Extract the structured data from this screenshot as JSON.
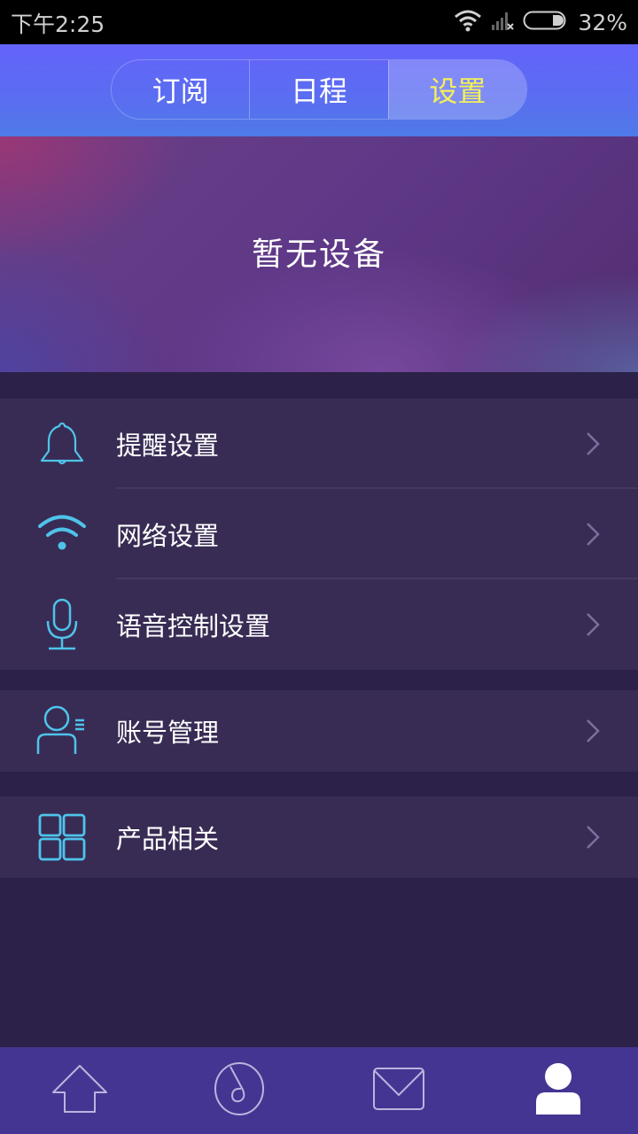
{
  "status_bar": {
    "time": "下午2:25",
    "battery_percent": "32%",
    "icons": [
      "wifi-icon",
      "cellular-no-signal-icon",
      "battery-icon"
    ]
  },
  "header": {
    "tabs": [
      {
        "label": "订阅",
        "active": false
      },
      {
        "label": "日程",
        "active": false
      },
      {
        "label": "设置",
        "active": true
      }
    ],
    "active_color": "#f3ef5a"
  },
  "banner": {
    "text": "暂无设备"
  },
  "settings": {
    "groups": [
      {
        "items": [
          {
            "label": "提醒设置",
            "icon": "bell-icon"
          },
          {
            "label": "网络设置",
            "icon": "wifi-icon"
          },
          {
            "label": "语音控制设置",
            "icon": "microphone-icon"
          }
        ]
      },
      {
        "items": [
          {
            "label": "账号管理",
            "icon": "user-list-icon"
          }
        ]
      },
      {
        "items": [
          {
            "label": "产品相关",
            "icon": "grid-icon"
          }
        ]
      }
    ],
    "icon_color": "#4fc3ea",
    "chevron_icon": "chevron-right-icon"
  },
  "tabbar": {
    "items": [
      {
        "icon": "home-icon",
        "active": false
      },
      {
        "icon": "music-icon",
        "active": false
      },
      {
        "icon": "mail-icon",
        "active": false
      },
      {
        "icon": "profile-icon",
        "active": true
      }
    ]
  }
}
